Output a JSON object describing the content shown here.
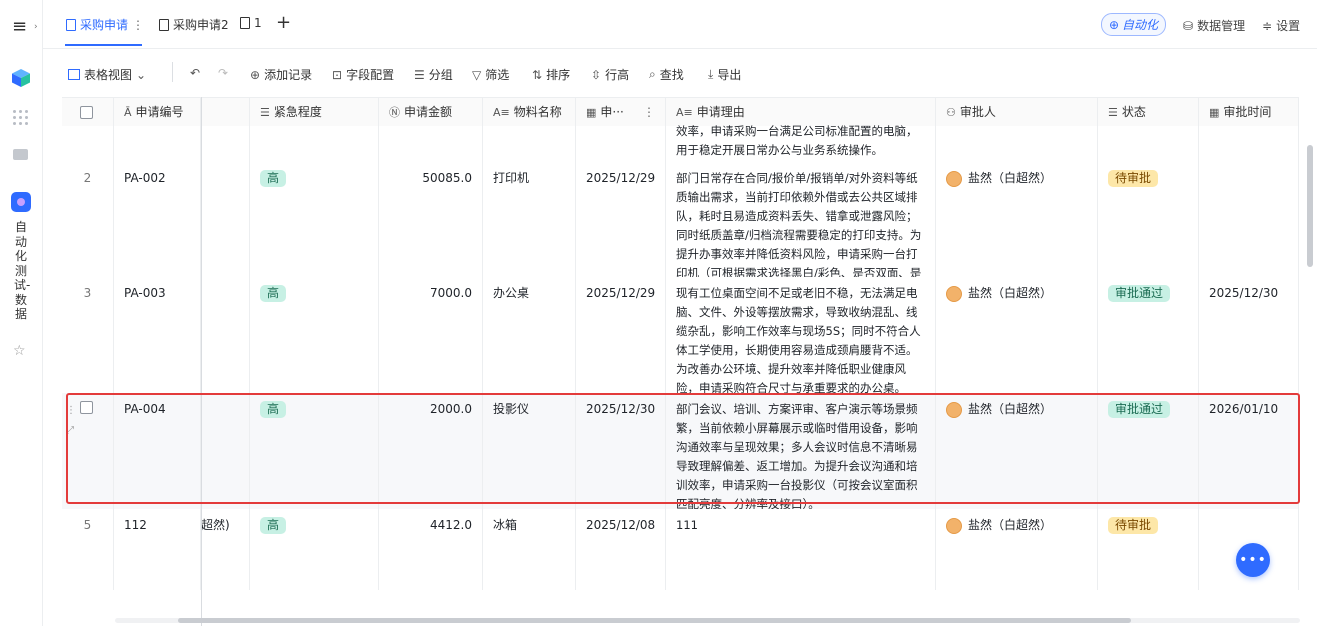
{
  "sidebar": {
    "app_name": "自动化测试-数据"
  },
  "tabs": [
    {
      "label": "采购申请",
      "more": "⋮"
    },
    {
      "label": "采购申请2"
    },
    {
      "label": "1"
    }
  ],
  "add_tab": "+",
  "topright": {
    "automation": "自动化",
    "data_manage": "数据管理",
    "settings": "设置"
  },
  "toolbar": {
    "view": "表格视图",
    "add_record": "添加记录",
    "field_config": "字段配置",
    "group": "分组",
    "filter": "筛选",
    "sort": "排序",
    "row_height": "行高",
    "find": "查找",
    "export": "导出"
  },
  "columns": {
    "code": "申请编号",
    "urgency": "紧急程度",
    "amount": "申请金额",
    "material": "物料名称",
    "date": "申···",
    "date_more": "⋮",
    "reason": "申请理由",
    "approver": "审批人",
    "status": "状态",
    "approve_time": "审批时间"
  },
  "rows": [
    {
      "idx": "",
      "reason": "效率，申请采购一台满足公司标准配置的电脑，用于稳定开展日常办公与业务系统操作。"
    },
    {
      "idx": "2",
      "code": "PA-002",
      "urgency": "高",
      "amount": "50085.0",
      "material": "打印机",
      "date": "2025/12/29",
      "reason": "部门日常存在合同/报价单/报销单/对外资料等纸质输出需求，当前打印依赖外借或去公共区域排队，耗时且易造成资料丢失、错拿或泄露风险；同时纸质盖章/归档流程需要稳定的打印支持。为提升办事效率并降低资料风险，申请采购一台打印机（可根据需求选择黑白/彩色、是否双面、是否扫描）。",
      "approver": "盐然（白超然）",
      "status": "待审批",
      "approve_time": ""
    },
    {
      "idx": "3",
      "code": "PA-003",
      "urgency": "高",
      "amount": "7000.0",
      "material": "办公桌",
      "date": "2025/12/29",
      "reason": "现有工位桌面空间不足或老旧不稳，无法满足电脑、文件、外设等摆放需求，导致收纳混乱、线缆杂乱，影响工作效率与现场5S；同时不符合人体工学使用，长期使用容易造成颈肩腰背不适。为改善办公环境、提升效率并降低职业健康风险，申请采购符合尺寸与承重要求的办公桌。",
      "approver": "盐然（白超然）",
      "status": "审批通过",
      "approve_time": "2025/12/30"
    },
    {
      "idx": "",
      "code": "PA-004",
      "urgency": "高",
      "amount": "2000.0",
      "material": "投影仪",
      "date": "2025/12/30",
      "reason": "部门会议、培训、方案评审、客户演示等场景频繁，当前依赖小屏幕展示或临时借用设备，影响沟通效率与呈现效果；多人会议时信息不清晰易导致理解偏差、返工增加。为提升会议沟通和培训效率，申请采购一台投影仪（可按会议室面积匹配亮度、分辨率及接口）。",
      "approver": "盐然（白超然）",
      "status": "审批通过",
      "approve_time": "2026/01/10"
    },
    {
      "idx": "5",
      "code": "112",
      "partial": "超然)",
      "urgency": "高",
      "amount": "4412.0",
      "material": "冰箱",
      "date": "2025/12/08",
      "reason": "111",
      "approver": "盐然（白超然）",
      "status": "待审批",
      "approve_time": ""
    }
  ],
  "fab": "•••"
}
